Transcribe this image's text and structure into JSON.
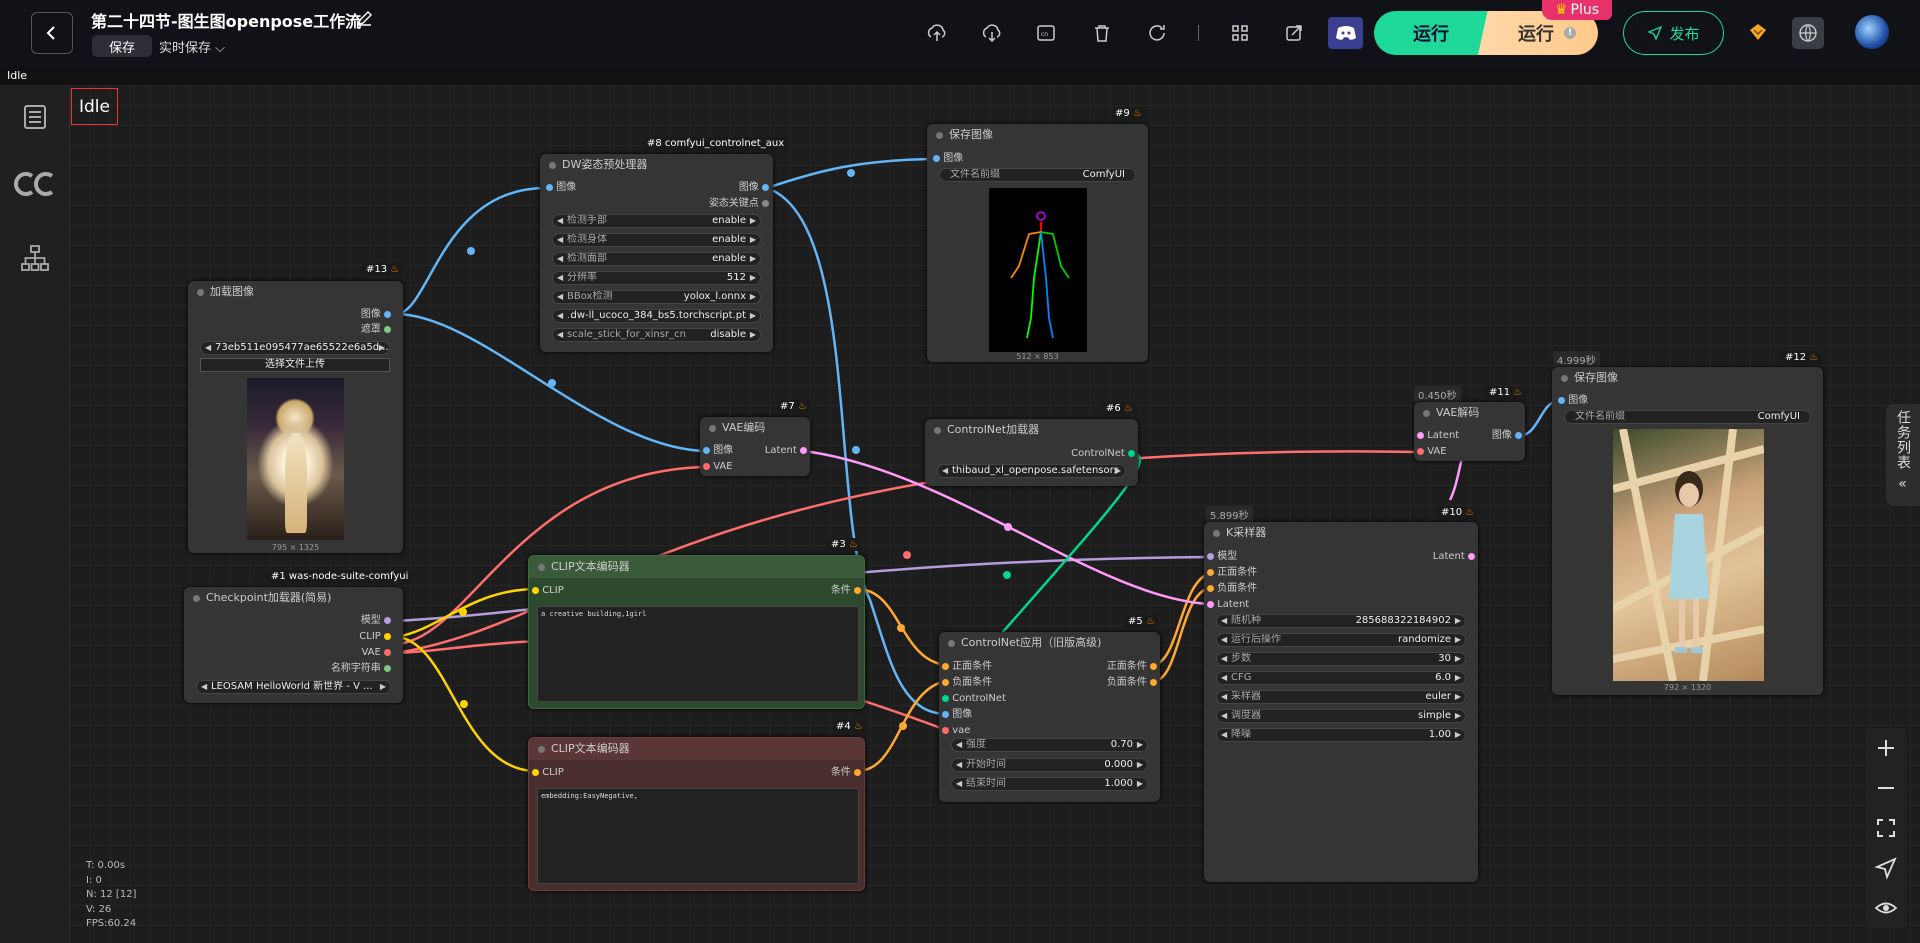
{
  "header": {
    "title": "第二十四节-图生图openpose工作流",
    "save_label": "保存",
    "autosave_label": "实时保存",
    "run_label": "运行",
    "run2_label": "运行",
    "plus_label": "Plus",
    "publish_label": "发布"
  },
  "status": "Idle",
  "canvas_status": "Idle",
  "stats": {
    "t": "T: 0.00s",
    "i": "I: 0",
    "n": "N: 12 [12]",
    "v": "V: 26",
    "fps": "FPS:60.24"
  },
  "task_list": "任务列表",
  "nodes": {
    "load_image": {
      "badge": "#13",
      "title": "加载图像",
      "out_image": "图像",
      "out_mask": "遮罩",
      "file": "73eb511e095477ae65522e6a5d ...",
      "upload": "选择文件上传",
      "dims": "795 × 1325"
    },
    "checkpoint": {
      "badge": "#1 was-node-suite-comfyui",
      "title": "Checkpoint加载器(简易)",
      "out_model": "模型",
      "out_clip": "CLIP",
      "out_vae": "VAE",
      "out_name": "名称字符串",
      "ckpt": "LEOSAM HelloWorld 新世界 - V ..."
    },
    "dw": {
      "badge": "#8 comfyui_controlnet_aux",
      "title": "DW姿态预处理器",
      "in_image": "图像",
      "out_image": "图像",
      "out_kp": "姿态关键点",
      "widgets": [
        {
          "label": "检测手部",
          "value": "enable"
        },
        {
          "label": "检测身体",
          "value": "enable"
        },
        {
          "label": "检测面部",
          "value": "enable"
        },
        {
          "label": "分辨率",
          "value": "512"
        },
        {
          "label": "BBox检测",
          "value": "yolox_l.onnx"
        },
        {
          "label": "...",
          "value": "dw-ll_ucoco_384_bs5.torchscript.pt"
        },
        {
          "label": "scale_stick_for_xinsr_cn",
          "value": "disable"
        }
      ]
    },
    "save9": {
      "badge": "#9",
      "title": "保存图像",
      "in_image": "图像",
      "prefix_label": "文件名前缀",
      "prefix_value": "ComfyUI",
      "dims": "512 × 853"
    },
    "vae_encode": {
      "badge": "#7",
      "title": "VAE编码",
      "in_image": "图像",
      "in_vae": "VAE",
      "out_latent": "Latent"
    },
    "cn_loader": {
      "badge": "#6",
      "title": "ControlNet加载器",
      "out": "ControlNet",
      "model": "thibaud_xl_openpose.safetensors"
    },
    "clip_pos": {
      "badge": "#3",
      "title": "CLIP文本编码器",
      "in_clip": "CLIP",
      "out_cond": "条件",
      "text": "a creative building,1girl"
    },
    "clip_neg": {
      "badge": "#4",
      "title": "CLIP文本编码器",
      "in_clip": "CLIP",
      "out_cond": "条件",
      "text": "embedding:EasyNegative,"
    },
    "cn_apply": {
      "badge": "#5",
      "title": "ControlNet应用（旧版高级)",
      "in_pos": "正面条件",
      "in_neg": "负面条件",
      "in_cn": "ControlNet",
      "in_image": "图像",
      "in_vae": "vae",
      "out_pos": "正面条件",
      "out_neg": "负面条件",
      "widgets": [
        {
          "label": "强度",
          "value": "0.70"
        },
        {
          "label": "开始时间",
          "value": "0.000"
        },
        {
          "label": "结束时间",
          "value": "1.000"
        }
      ]
    },
    "ksampler": {
      "badge": "#10",
      "timer": "5.899秒",
      "title": "K采样器",
      "in_model": "模型",
      "in_pos": "正面条件",
      "in_neg": "负面条件",
      "in_latent": "Latent",
      "out_latent": "Latent",
      "widgets": [
        {
          "label": "随机种",
          "value": "285688322184902"
        },
        {
          "label": "运行后操作",
          "value": "randomize"
        },
        {
          "label": "步数",
          "value": "30"
        },
        {
          "label": "CFG",
          "value": "6.0"
        },
        {
          "label": "采样器",
          "value": "euler"
        },
        {
          "label": "调度器",
          "value": "simple"
        },
        {
          "label": "降噪",
          "value": "1.00"
        }
      ]
    },
    "vae_decode": {
      "badge": "#11",
      "timer": "0.450秒",
      "title": "VAE解码",
      "in_latent": "Latent",
      "in_vae": "VAE",
      "out_image": "图像"
    },
    "save12": {
      "badge": "#12",
      "timer": "4.999秒",
      "title": "保存图像",
      "in_image": "图像",
      "prefix_label": "文件名前缀",
      "prefix_value": "ComfyUI",
      "dims": "792 × 1320"
    }
  },
  "colors": {
    "image": "#64b5f6",
    "latent": "#ff9cf9",
    "vae": "#ff6e6e",
    "clip": "#ffd500",
    "conditioning": "#ffa931",
    "model": "#b39ddb",
    "controlnet": "#00d78d",
    "accent": "#1fd99a"
  }
}
